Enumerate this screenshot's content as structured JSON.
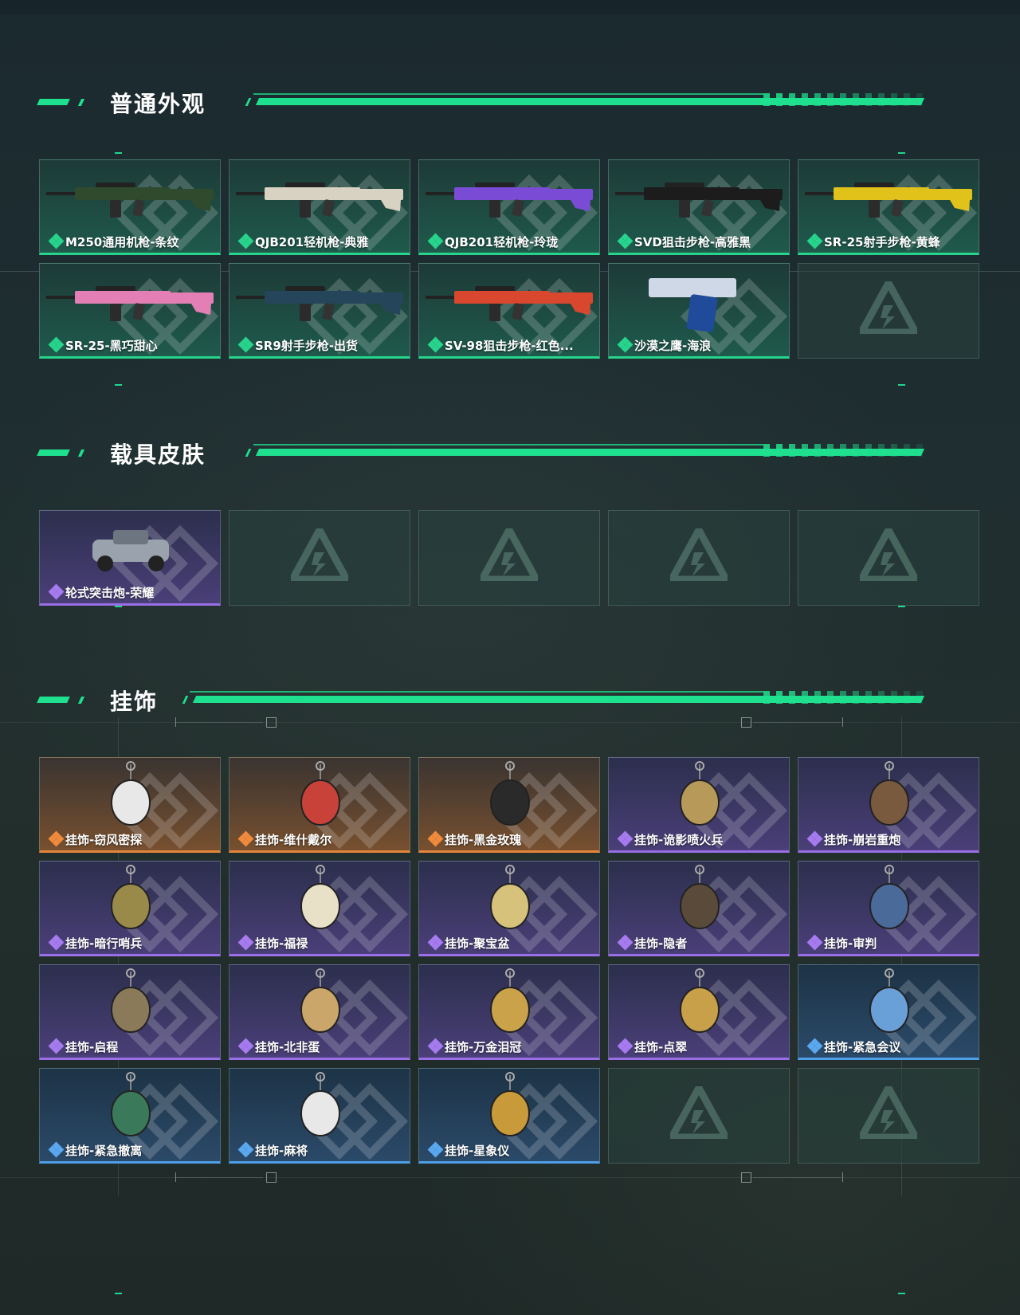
{
  "sections": [
    {
      "title": "普通外观",
      "cards": [
        {
          "label": "M250通用机枪-条纹",
          "rarity": "green",
          "icon": "machine-gun-image"
        },
        {
          "label": "QJB201轻机枪-典雅",
          "rarity": "green",
          "icon": "light-machine-gun-image"
        },
        {
          "label": "QJB201轻机枪-玲珑",
          "rarity": "green",
          "icon": "light-machine-gun-image"
        },
        {
          "label": "SVD狙击步枪-高雅黑",
          "rarity": "green",
          "icon": "sniper-rifle-image"
        },
        {
          "label": "SR-25射手步枪-黄蜂",
          "rarity": "green",
          "icon": "marksman-rifle-image"
        },
        {
          "label": "SR-25-黑巧甜心",
          "rarity": "green",
          "icon": "marksman-rifle-image"
        },
        {
          "label": "SR9射手步枪-出货",
          "rarity": "green",
          "icon": "marksman-rifle-image"
        },
        {
          "label": "SV-98狙击步枪-红色...",
          "rarity": "green",
          "icon": "sniper-rifle-image"
        },
        {
          "label": "沙漠之鹰-海浪",
          "rarity": "green",
          "icon": "pistol-image"
        },
        {
          "label": "",
          "rarity": "empty",
          "icon": "empty-slot-logo-icon"
        }
      ]
    },
    {
      "title": "载具皮肤",
      "cards": [
        {
          "label": "轮式突击炮-荣耀",
          "rarity": "purple",
          "icon": "vehicle-image"
        },
        {
          "label": "",
          "rarity": "empty",
          "icon": "empty-slot-logo-icon"
        },
        {
          "label": "",
          "rarity": "empty",
          "icon": "empty-slot-logo-icon"
        },
        {
          "label": "",
          "rarity": "empty",
          "icon": "empty-slot-logo-icon"
        },
        {
          "label": "",
          "rarity": "empty",
          "icon": "empty-slot-logo-icon"
        }
      ]
    },
    {
      "title": "挂饰",
      "cards": [
        {
          "label": "挂饰-窃风密探",
          "rarity": "orange",
          "icon": "charm-image"
        },
        {
          "label": "挂饰-维什戴尔",
          "rarity": "orange",
          "icon": "charm-image"
        },
        {
          "label": "挂饰-黑金玫瑰",
          "rarity": "orange",
          "icon": "charm-image"
        },
        {
          "label": "挂饰-诡影喷火兵",
          "rarity": "purple",
          "icon": "charm-image"
        },
        {
          "label": "挂饰-崩岩重炮",
          "rarity": "purple",
          "icon": "charm-image"
        },
        {
          "label": "挂饰-暗行哨兵",
          "rarity": "purple",
          "icon": "charm-image"
        },
        {
          "label": "挂饰-福禄",
          "rarity": "purple",
          "icon": "charm-image"
        },
        {
          "label": "挂饰-聚宝盆",
          "rarity": "purple",
          "icon": "charm-image"
        },
        {
          "label": "挂饰-隐者",
          "rarity": "purple",
          "icon": "charm-image"
        },
        {
          "label": "挂饰-审判",
          "rarity": "purple",
          "icon": "charm-image"
        },
        {
          "label": "挂饰-启程",
          "rarity": "purple",
          "icon": "charm-image"
        },
        {
          "label": "挂饰-北非蛋",
          "rarity": "purple",
          "icon": "charm-image"
        },
        {
          "label": "挂饰-万金泪冠",
          "rarity": "purple",
          "icon": "charm-image"
        },
        {
          "label": "挂饰-点翠",
          "rarity": "purple",
          "icon": "charm-image"
        },
        {
          "label": "挂饰-紧急会议",
          "rarity": "blue",
          "icon": "charm-image"
        },
        {
          "label": "挂饰-紧急撤离",
          "rarity": "blue",
          "icon": "charm-image"
        },
        {
          "label": "挂饰-麻将",
          "rarity": "blue",
          "icon": "charm-image"
        },
        {
          "label": "挂饰-星象仪",
          "rarity": "blue",
          "icon": "charm-image"
        },
        {
          "label": "",
          "rarity": "empty",
          "icon": "empty-slot-logo-icon"
        },
        {
          "label": "",
          "rarity": "empty",
          "icon": "empty-slot-logo-icon"
        }
      ]
    }
  ],
  "colors": {
    "accent": "#1fe08f",
    "green_rarity": "#27d48c",
    "purple_rarity": "#9a6ee6",
    "orange_rarity": "#e5853b",
    "blue_rarity": "#4f9ee8"
  }
}
